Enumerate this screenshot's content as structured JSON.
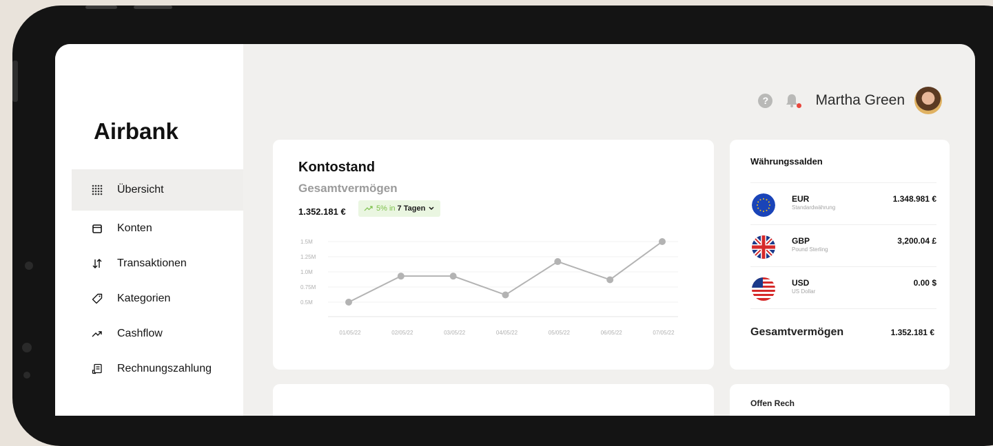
{
  "app": {
    "name": "Airbank"
  },
  "sidebar": {
    "items": [
      {
        "label": "Übersicht",
        "icon": "grid-dots-icon",
        "active": true
      },
      {
        "label": "Konten",
        "icon": "wallet-icon"
      },
      {
        "label": "Transaktionen",
        "icon": "arrows-updown-icon"
      },
      {
        "label": "Kategorien",
        "icon": "tag-icon"
      },
      {
        "label": "Cashflow",
        "icon": "trend-icon"
      },
      {
        "label": "Rechnungszahlung",
        "icon": "receipt-icon"
      }
    ]
  },
  "header": {
    "user_name": "Martha Green",
    "notification_dot_color": "#e8463c"
  },
  "balance_card": {
    "title": "Kontostand",
    "subtitle": "Gesamtvermögen",
    "amount": "1.352.181 €",
    "change": {
      "percent": "5% in",
      "period": "7 Tagen"
    },
    "accent_color": "#7cc04a"
  },
  "chart_data": {
    "type": "line",
    "title": "",
    "xlabel": "",
    "ylabel": "",
    "x": [
      "01/05/22",
      "02/05/22",
      "03/05/22",
      "04/05/22",
      "05/05/22",
      "06/05/22",
      "07/05/22"
    ],
    "y": [
      0.5,
      0.93,
      0.93,
      0.62,
      1.17,
      0.87,
      1.5
    ],
    "y_unit": "M",
    "y_ticks": [
      "1.5M",
      "1.25M",
      "1.0M",
      "0.75M",
      "0.5M"
    ],
    "ylim": [
      0.5,
      1.5
    ],
    "grid": true,
    "line_color": "#b3b3b3"
  },
  "currency_card": {
    "title": "Währungssalden",
    "rows": [
      {
        "code": "EUR",
        "name": "Standardwährung",
        "amount": "1.348.981 €",
        "flag": "eu-flag-icon"
      },
      {
        "code": "GBP",
        "name": "Pound Sterling",
        "amount": "3,200.04 £",
        "flag": "uk-flag-icon"
      },
      {
        "code": "USD",
        "name": "US Dollar",
        "amount": "0.00 $",
        "flag": "us-flag-icon"
      }
    ],
    "total_label": "Gesamtvermögen",
    "total_value": "1.352.181 €"
  },
  "bottom_right_card": {
    "title_partial": "Offen Rech"
  }
}
